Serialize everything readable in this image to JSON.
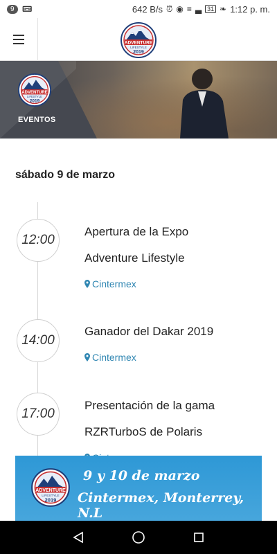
{
  "status_bar": {
    "notification_count": "9",
    "speed": "642 B/s",
    "battery": "31",
    "time": "1:12 p. m."
  },
  "app_bar": {
    "logo_icon": "adventure-lifestyle-2019-logo"
  },
  "hero": {
    "title": "EVENTOS"
  },
  "date_heading": "sábado 9 de marzo",
  "events": [
    {
      "time": "12:00",
      "title_line1": "Apertura de la Expo",
      "title_line2": "Adventure Lifestyle",
      "location": "Cintermex"
    },
    {
      "time": "14:00",
      "title_line1": "Ganador del Dakar 2019",
      "title_line2": "",
      "location": "Cintermex"
    },
    {
      "time": "17:00",
      "title_line1": "Presentación de la gama",
      "title_line2": "RZRTurboS de Polaris",
      "location": "Cintermex"
    }
  ],
  "banner": {
    "line1": "9 y 10 de marzo",
    "line2": "Cintermex, Monterrey, N.L"
  },
  "colors": {
    "accent_blue": "#2f86b2",
    "banner_blue": "#2e98d6",
    "hero_panel": "#454850"
  }
}
